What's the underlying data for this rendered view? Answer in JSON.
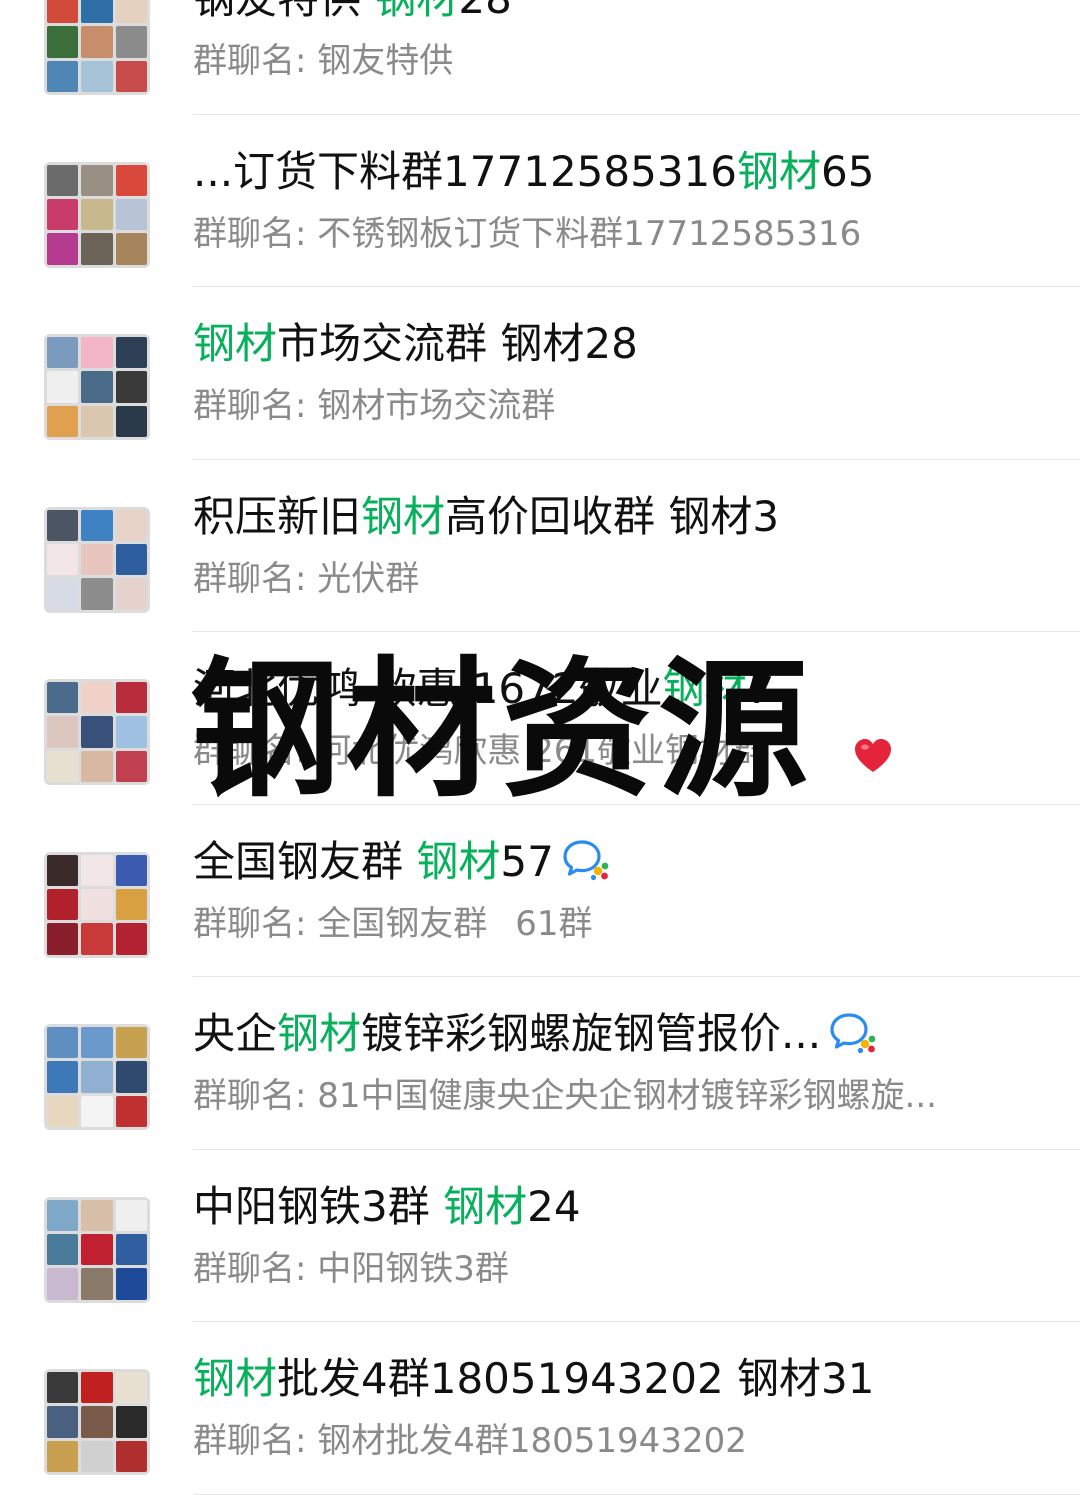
{
  "overlay_text": "钢材资源",
  "colors": {
    "highlight": "#07b05a",
    "title_text": "#111111",
    "subtitle_text": "#8a8a8a",
    "divider": "#e6e6e6",
    "chat_icon_blue": "#2a8bf2",
    "heart_red": "#e5243b"
  },
  "groups": [
    {
      "title": [
        {
          "t": "钢友特供 "
        },
        {
          "t": "钢材",
          "hl": true
        },
        {
          "t": "28"
        }
      ],
      "subtitle": "群聊名: 钢友特供",
      "extra": "",
      "icon": "",
      "avatar": [
        "#d24a3a",
        "#2f6fa8",
        "#e5d1c0",
        "#3b6e3a",
        "#c68e6a",
        "#8b8b8b",
        "#4f86b6",
        "#a6c3d8",
        "#c94c4c"
      ]
    },
    {
      "title": [
        {
          "t": "...订货下料群17712585316"
        },
        {
          "t": "钢材",
          "hl": true
        },
        {
          "t": "65"
        }
      ],
      "subtitle": "群聊名: 不锈钢板订货下料群17712585316",
      "extra": "",
      "icon": "",
      "avatar": [
        "#6b6b6b",
        "#9a8f85",
        "#d9493b",
        "#c93b6a",
        "#c7b88e",
        "#b7c4d6",
        "#b43b8f",
        "#6b6358",
        "#a7855c"
      ]
    },
    {
      "title": [
        {
          "t": "钢材",
          "hl": true
        },
        {
          "t": "市场交流群 钢材28"
        }
      ],
      "subtitle": "群聊名: 钢材市场交流群",
      "extra": "",
      "icon": "",
      "avatar": [
        "#7a9bbd",
        "#f2b6c6",
        "#2d3f55",
        "#f0f0f0",
        "#4a6a8a",
        "#3a3a3a",
        "#e0a050",
        "#d9c7b0",
        "#2a3a4a"
      ]
    },
    {
      "title": [
        {
          "t": "积压新旧"
        },
        {
          "t": "钢材",
          "hl": true
        },
        {
          "t": "高价回收群 钢材3"
        }
      ],
      "subtitle": "群聊名: 光伏群",
      "extra": "",
      "icon": "",
      "avatar": [
        "#4b5563",
        "#3f82c4",
        "#e8d3c9",
        "#f2e6e6",
        "#e9c5c0",
        "#2d5fa0",
        "#d6dbe6",
        "#8d8d8d",
        "#e6d2cc"
      ]
    },
    {
      "title": [
        {
          "t": "河北优鸿 欣惠 1672敬业"
        },
        {
          "t": "钢材",
          "hl": true
        },
        {
          "t": "7"
        }
      ],
      "subtitle": "群聊名: 河北优鸿欣惠 261敬业钢材群",
      "extra": "",
      "icon": "",
      "avatar": [
        "#4b6b8c",
        "#f0d2c8",
        "#b82c3c",
        "#dcc7c0",
        "#37517a",
        "#9fc0e0",
        "#e8e0d0",
        "#d8b8a0",
        "#c04050"
      ]
    },
    {
      "title": [
        {
          "t": "全国钢友群 "
        },
        {
          "t": "钢材",
          "hl": true
        },
        {
          "t": "57"
        }
      ],
      "subtitle": "群聊名: 全国钢友群",
      "extra": "61群",
      "icon": "chat-bubble-icon",
      "avatar": [
        "#3a2a2a",
        "#f2e6e6",
        "#3b5bb0",
        "#b2202c",
        "#f0e0e0",
        "#d8a040",
        "#8b1e2c",
        "#c83a3a",
        "#b32230"
      ]
    },
    {
      "title": [
        {
          "t": "央企"
        },
        {
          "t": "钢材",
          "hl": true
        },
        {
          "t": "镀锌彩钢螺旋钢管报价..."
        }
      ],
      "subtitle": "群聊名: 81中国健康央企央企钢材镀锌彩钢螺旋...",
      "extra": "",
      "icon": "chat-bubble-icon",
      "avatar": [
        "#5f8fc0",
        "#6a9acb",
        "#c7a050",
        "#3d78b8",
        "#8fb0d0",
        "#2e4a6e",
        "#e8d8c0",
        "#f4f4f4",
        "#c03030"
      ]
    },
    {
      "title": [
        {
          "t": "中阳钢铁3群 "
        },
        {
          "t": "钢材",
          "hl": true
        },
        {
          "t": "24"
        }
      ],
      "subtitle": "群聊名: 中阳钢铁3群",
      "extra": "",
      "icon": "",
      "avatar": [
        "#7fa8c8",
        "#d8c0a8",
        "#f0f0f0",
        "#4a7a9a",
        "#c02030",
        "#2f5fa0",
        "#c8b8d0",
        "#8a7a6a",
        "#1e4a9a"
      ]
    },
    {
      "title": [
        {
          "t": "钢材",
          "hl": true
        },
        {
          "t": "批发4群18051943202 钢材31"
        }
      ],
      "subtitle": "群聊名: 钢材批发4群18051943202",
      "extra": "",
      "icon": "",
      "avatar": [
        "#3a3a3a",
        "#c02020",
        "#e8e0d0",
        "#4a6080",
        "#7a5a4a",
        "#2a2a2a",
        "#c8a050",
        "#d0d0d0",
        "#b03030"
      ]
    }
  ]
}
